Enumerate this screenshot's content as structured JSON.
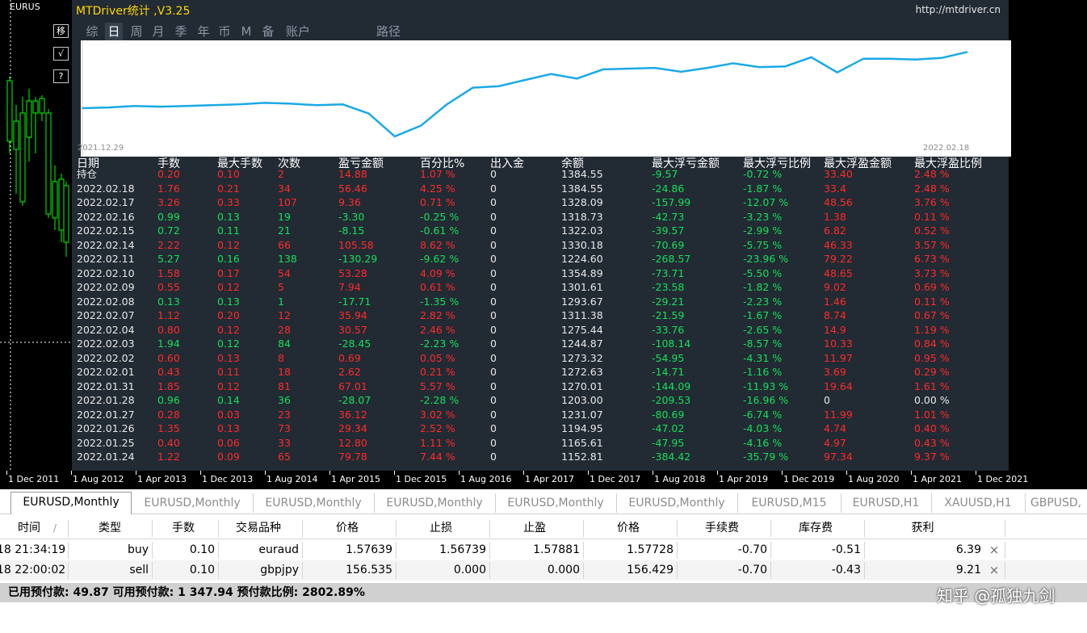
{
  "chart": {
    "symbol_label": "EURUS",
    "side_buttons": [
      "移",
      "√",
      "?"
    ],
    "date_axis": [
      "1 Dec 2011",
      "1 Aug 2012",
      "1 Apr 2013",
      "1 Dec 2013",
      "1 Aug 2014",
      "1 Apr 2015",
      "1 Dec 2015",
      "1 Aug 2016",
      "1 Apr 2017",
      "1 Dec 2017",
      "1 Aug 2018",
      "1 Apr 2019",
      "1 Dec 2019",
      "1 Aug 2020",
      "1 Apr 2021",
      "1 Dec 2021"
    ],
    "colors": {
      "background": "#000000",
      "bull": "#00ff00",
      "grid": "#ffffff"
    }
  },
  "panel": {
    "title": "MTDriver统计 ,V3.25",
    "url": "http://mtdriver.cn",
    "tabs": [
      "综",
      "日",
      "周",
      "月",
      "季",
      "年",
      "币",
      "M",
      "备",
      "账户",
      "路径"
    ],
    "active_tab": "日",
    "curve_start_date": "2021.12.29",
    "curve_end_date": "2022.02.18",
    "colors": {
      "background": "#222a33",
      "curve": "#1aa9e6",
      "positive": "#14e05a",
      "negative": "#ff2a2a"
    }
  },
  "chart_data": {
    "type": "line",
    "series": [
      {
        "values": [
          1203,
          1204,
          1206,
          1205,
          1206,
          1207,
          1208,
          1210,
          1209,
          1207,
          1208,
          1196,
          1166,
          1180,
          1208,
          1230,
          1232,
          1240,
          1248,
          1242,
          1254,
          1255,
          1256,
          1251,
          1256,
          1262,
          1257,
          1258,
          1270,
          1250,
          1268,
          1268,
          1267,
          1269,
          1277
        ]
      }
    ]
  },
  "stats": {
    "headers": [
      "日期",
      "手数",
      "最大手数",
      "次数",
      "盈亏金额",
      "百分比%",
      "出入金",
      "余额",
      "最大浮亏金额",
      "最大浮亏比例",
      "最大浮盈金额",
      "最大浮盈比例"
    ],
    "rows": [
      [
        "持仓",
        "0.20",
        "0.10",
        "2",
        "14.88",
        "1.07 %",
        "0",
        "1384.55",
        "-9.57",
        "-0.72 %",
        "33.40",
        "2.48 %"
      ],
      [
        "2022.02.18",
        "1.76",
        "0.21",
        "34",
        "56.46",
        "4.25 %",
        "0",
        "1384.55",
        "-24.86",
        "-1.87 %",
        "33.4",
        "2.48 %"
      ],
      [
        "2022.02.17",
        "3.26",
        "0.33",
        "107",
        "9.36",
        "0.71 %",
        "0",
        "1328.09",
        "-157.99",
        "-12.07 %",
        "48.56",
        "3.76 %"
      ],
      [
        "2022.02.16",
        "0.99",
        "0.13",
        "19",
        "-3.30",
        "-0.25 %",
        "0",
        "1318.73",
        "-42.73",
        "-3.23 %",
        "1.38",
        "0.11 %"
      ],
      [
        "2022.02.15",
        "0.72",
        "0.11",
        "21",
        "-8.15",
        "-0.61 %",
        "0",
        "1322.03",
        "-39.57",
        "-2.99 %",
        "6.82",
        "0.52 %"
      ],
      [
        "2022.02.14",
        "2.22",
        "0.12",
        "66",
        "105.58",
        "8.62 %",
        "0",
        "1330.18",
        "-70.69",
        "-5.75 %",
        "46.33",
        "3.57 %"
      ],
      [
        "2022.02.11",
        "5.27",
        "0.16",
        "138",
        "-130.29",
        "-9.62 %",
        "0",
        "1224.60",
        "-268.57",
        "-23.96 %",
        "79.22",
        "6.73 %"
      ],
      [
        "2022.02.10",
        "1.58",
        "0.17",
        "54",
        "53.28",
        "4.09 %",
        "0",
        "1354.89",
        "-73.71",
        "-5.50 %",
        "48.65",
        "3.73 %"
      ],
      [
        "2022.02.09",
        "0.55",
        "0.12",
        "5",
        "7.94",
        "0.61 %",
        "0",
        "1301.61",
        "-23.58",
        "-1.82 %",
        "9.02",
        "0.69 %"
      ],
      [
        "2022.02.08",
        "0.13",
        "0.13",
        "1",
        "-17.71",
        "-1.35 %",
        "0",
        "1293.67",
        "-29.21",
        "-2.23 %",
        "1.46",
        "0.11 %"
      ],
      [
        "2022.02.07",
        "1.12",
        "0.20",
        "12",
        "35.94",
        "2.82 %",
        "0",
        "1311.38",
        "-21.59",
        "-1.67 %",
        "8.74",
        "0.67 %"
      ],
      [
        "2022.02.04",
        "0.80",
        "0.12",
        "28",
        "30.57",
        "2.46 %",
        "0",
        "1275.44",
        "-33.76",
        "-2.65 %",
        "14.9",
        "1.19 %"
      ],
      [
        "2022.02.03",
        "1.94",
        "0.12",
        "84",
        "-28.45",
        "-2.23 %",
        "0",
        "1244.87",
        "-108.14",
        "-8.57 %",
        "10.33",
        "0.84 %"
      ],
      [
        "2022.02.02",
        "0.60",
        "0.13",
        "8",
        "0.69",
        "0.05 %",
        "0",
        "1273.32",
        "-54.95",
        "-4.31 %",
        "11.97",
        "0.95 %"
      ],
      [
        "2022.02.01",
        "0.43",
        "0.11",
        "18",
        "2.62",
        "0.21 %",
        "0",
        "1272.63",
        "-14.71",
        "-1.16 %",
        "3.69",
        "0.29 %"
      ],
      [
        "2022.01.31",
        "1.85",
        "0.12",
        "81",
        "67.01",
        "5.57 %",
        "0",
        "1270.01",
        "-144.09",
        "-11.93 %",
        "19.64",
        "1.61 %"
      ],
      [
        "2022.01.28",
        "0.96",
        "0.14",
        "36",
        "-28.07",
        "-2.28 %",
        "0",
        "1203.00",
        "-209.53",
        "-16.96 %",
        "0",
        "0.00 %"
      ],
      [
        "2022.01.27",
        "0.28",
        "0.03",
        "23",
        "36.12",
        "3.02 %",
        "0",
        "1231.07",
        "-80.69",
        "-6.74 %",
        "11.99",
        "1.01 %"
      ],
      [
        "2022.01.26",
        "1.35",
        "0.13",
        "73",
        "29.34",
        "2.52 %",
        "0",
        "1194.95",
        "-47.02",
        "-4.03 %",
        "4.74",
        "0.40 %"
      ],
      [
        "2022.01.25",
        "0.40",
        "0.06",
        "33",
        "12.80",
        "1.11 %",
        "0",
        "1165.61",
        "-47.95",
        "-4.16 %",
        "4.97",
        "0.43 %"
      ],
      [
        "2022.01.24",
        "1.22",
        "0.09",
        "65",
        "79.78",
        "7.44 %",
        "0",
        "1152.81",
        "-384.42",
        "-35.79 %",
        "97.34",
        "9.37 %"
      ]
    ]
  },
  "chart_tabs": [
    "EURUSD,Monthly",
    "EURUSD,Monthly",
    "EURUSD,Monthly",
    "EURUSD,Monthly",
    "EURUSD,Monthly",
    "EURUSD,Monthly",
    "EURUSD,M15",
    "EURUSD,H1",
    "XAUUSD,H1",
    "GBPUSD,"
  ],
  "trades": {
    "headers": [
      "时间",
      "类型",
      "手数",
      "交易品种",
      "价格",
      "止损",
      "止盈",
      "价格",
      "手续费",
      "库存费",
      "获利"
    ],
    "sort_indicator": "/",
    "rows": [
      [
        "18 21:34:19",
        "buy",
        "0.10",
        "euraud",
        "1.57639",
        "1.56739",
        "1.57881",
        "1.57728",
        "-0.70",
        "-0.51",
        "6.39"
      ],
      [
        "18 22:00:02",
        "sell",
        "0.10",
        "gbpjpy",
        "156.535",
        "0.000",
        "0.000",
        "156.429",
        "-0.70",
        "-0.43",
        "9.21"
      ]
    ],
    "close_icon": "×"
  },
  "status": {
    "text": "已用预付款: 49.87  可用预付款: 1 347.94  预付款比例: 2802.89%"
  },
  "watermark": {
    "text": "知乎 @孤独九剑"
  }
}
